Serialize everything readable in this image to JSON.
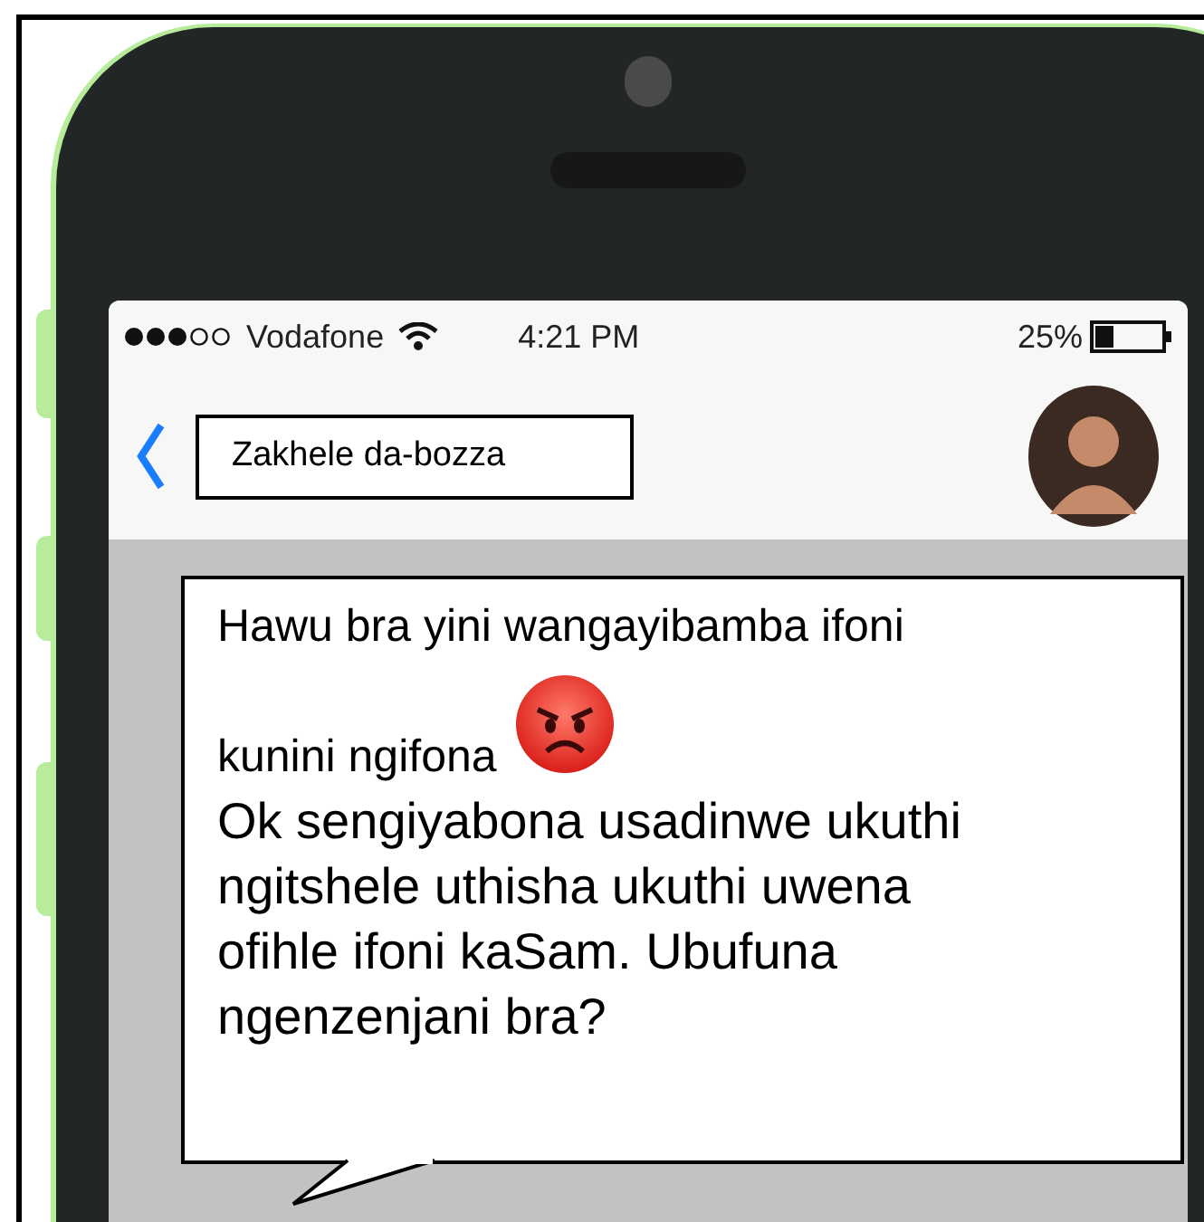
{
  "status_bar": {
    "carrier": "Vodafone",
    "time": "4:21 PM",
    "battery": "25%"
  },
  "header": {
    "title": "Zakhele da-bozza"
  },
  "messages": [
    {
      "lines": [
        "Hawu bra yini wangayibamba ifoni",
        "kunini ngifona"
      ],
      "kind": "with-emoji"
    },
    {
      "lines": [
        "Ok sengiyabona usadinwe ukuthi ngitshele uthisha ukuthi uwena ofihle ifoni kaSam. Ubufuna ngenzenjani bra?"
      ],
      "kind": "plain"
    }
  ]
}
